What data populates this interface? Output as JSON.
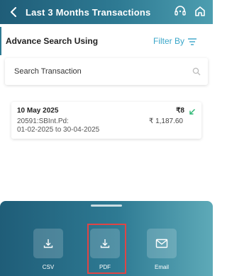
{
  "header": {
    "title": "Last 3 Months Transactions",
    "back_icon": "chevron-left-icon",
    "support_icon": "headset-icon",
    "home_icon": "home-icon"
  },
  "search": {
    "advanced_label": "Advance Search Using",
    "filter_label": "Filter By",
    "placeholder": "Search Transaction"
  },
  "transactions": [
    {
      "date": "10 May 2025",
      "reference_line": "20591:SBInt.Pd:",
      "period": "01-02-2025 to 30-04-2025",
      "small_amount": "₹8",
      "amount": "₹ 1,187.60",
      "direction_icon": "arrow-down-left-icon"
    }
  ],
  "export": {
    "csv_label": "CSV",
    "pdf_label": "PDF",
    "email_label": "Email"
  },
  "colors": {
    "header_gradient_start": "#1f5d78",
    "header_gradient_end": "#4d9eb0",
    "accent": "#3aa6c9",
    "credit_green": "#2bb673",
    "highlight_red": "#e04545"
  }
}
